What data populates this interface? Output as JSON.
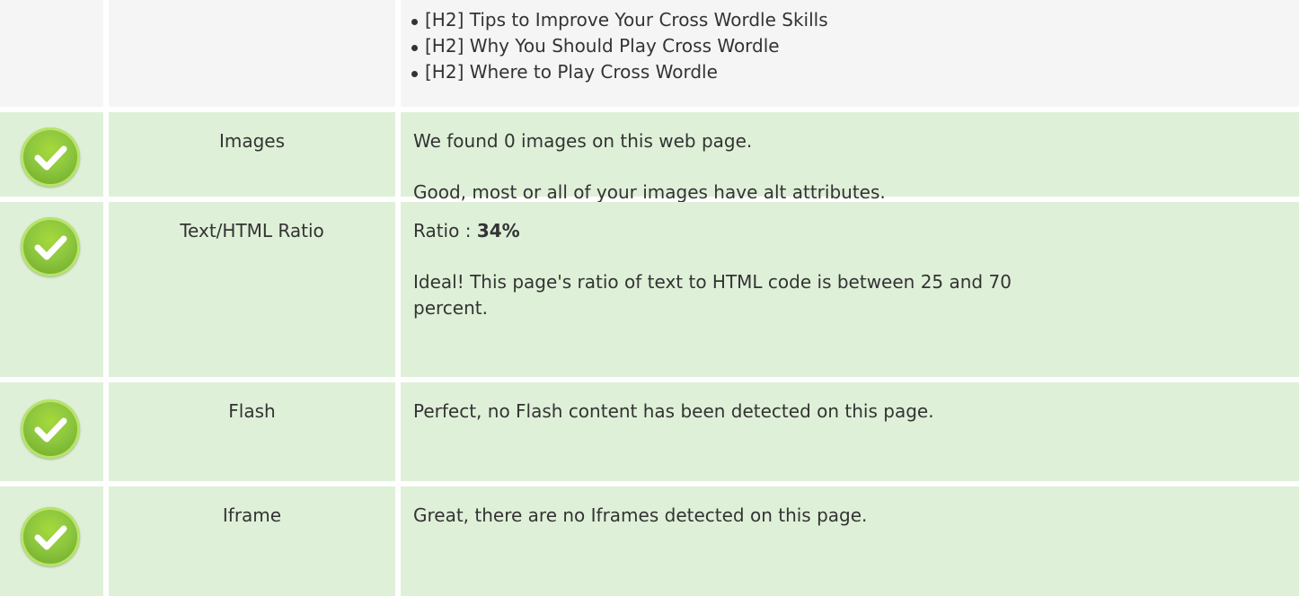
{
  "headings_section": {
    "items": [
      "[H2] Tips to Improve Your Cross Wordle Skills",
      "[H2] Why You Should Play Cross Wordle",
      "[H2] Where to Play Cross Wordle"
    ]
  },
  "checks": [
    {
      "label": "Images",
      "icon": "check-circle-icon",
      "status": "pass",
      "line1": "We found 0 images on this web page.",
      "line2": "Good, most or all of your images have alt attributes."
    },
    {
      "label": "Text/HTML Ratio",
      "icon": "check-circle-icon",
      "status": "pass",
      "line1_prefix": "Ratio : ",
      "line1_value": "34%",
      "line2": "Ideal! This page's ratio of text to HTML code is between 25 and 70 percent."
    },
    {
      "label": "Flash",
      "icon": "check-circle-icon",
      "status": "pass",
      "line1": "Perfect, no Flash content has been detected on this page."
    },
    {
      "label": "Iframe",
      "icon": "check-circle-icon",
      "status": "pass",
      "line1": "Great, there are no Iframes detected on this page."
    }
  ],
  "colors": {
    "pass_row_bg": "#dff0d8",
    "neutral_row_bg": "#f5f5f5",
    "check_green": "#8cc63f",
    "text": "#333333"
  }
}
